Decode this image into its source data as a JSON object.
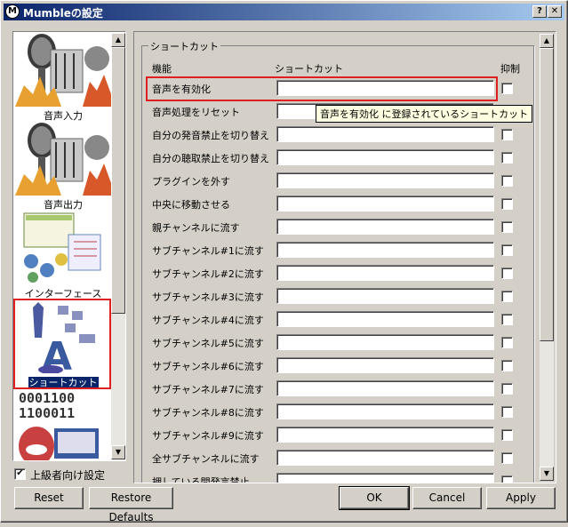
{
  "window": {
    "title": "Mumbleの設定",
    "help_glyph": "?",
    "close_glyph": "✕",
    "logo_letter": "M"
  },
  "sidebar": {
    "items": [
      {
        "label": "音声入力",
        "icon": "microphone-icon"
      },
      {
        "label": "音声出力",
        "icon": "speaker-icon"
      },
      {
        "label": "インターフェース",
        "icon": "interface-icon"
      },
      {
        "label": "ショートカット",
        "icon": "keyboard-shortcut-icon",
        "selected": true
      },
      {
        "label": "",
        "icon": "network-icon",
        "text": "0001100 1100011"
      }
    ]
  },
  "shortcuts": {
    "group_title": "ショートカット",
    "col_function": "機能",
    "col_shortcut": "ショートカット",
    "col_suppress": "抑制",
    "rows": [
      "音声を有効化",
      "音声処理をリセット",
      "自分の発音禁止を切り替え",
      "自分の聴取禁止を切り替え",
      "プラグインを外す",
      "中央に移動させる",
      "親チャンネルに流す",
      "サブチャンネル#1に流す",
      "サブチャンネル#2に流す",
      "サブチャンネル#3に流す",
      "サブチャンネル#4に流す",
      "サブチャンネル#5に流す",
      "サブチャンネル#6に流す",
      "サブチャンネル#7に流す",
      "サブチャンネル#8に流す",
      "サブチャンネル#9に流す",
      "全サブチャンネルに流す",
      "押している間発言禁止"
    ],
    "tooltip": "音声を有効化 に登録されているショートカット"
  },
  "advanced": {
    "label": "上級者向け設定",
    "checked": true,
    "check_glyph": "✔"
  },
  "buttons": {
    "reset": "Reset",
    "restore": "Restore Defaults",
    "ok": "OK",
    "cancel": "Cancel",
    "apply": "Apply"
  },
  "colors": {
    "titlebar_start": "#0a246a",
    "highlight": "#e02020",
    "selected": "#0a246a"
  }
}
